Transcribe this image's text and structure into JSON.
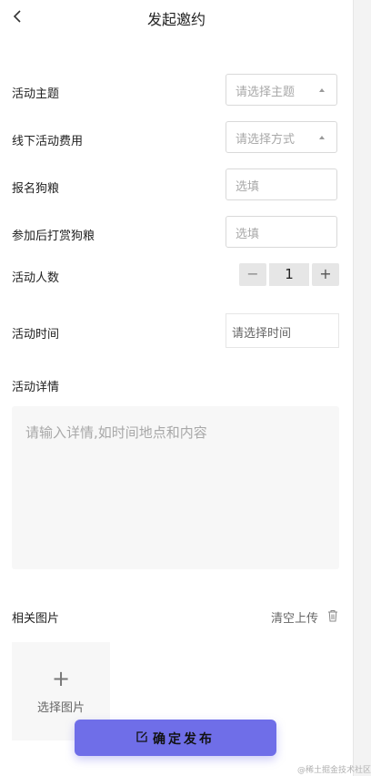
{
  "header": {
    "title": "发起邀约"
  },
  "form": {
    "topic": {
      "label": "活动主题",
      "placeholder": "请选择主题"
    },
    "offline_fee": {
      "label": "线下活动费用",
      "placeholder": "请选择方式"
    },
    "signup_food": {
      "label": "报名狗粮",
      "placeholder": "选填"
    },
    "reward_food": {
      "label": "参加后打赏狗粮",
      "placeholder": "选填"
    },
    "people": {
      "label": "活动人数",
      "value": "1",
      "minus": "−",
      "plus": "+"
    },
    "time": {
      "label": "活动时间",
      "placeholder": "请选择时间"
    },
    "details": {
      "label": "活动详情",
      "placeholder": "请输入详情,如时间地点和内容"
    },
    "images": {
      "label": "相关图片",
      "clear_label": "清空上传",
      "upload_plus": "+",
      "upload_label": "选择图片"
    }
  },
  "actions": {
    "publish_label": "确定发布"
  },
  "watermark": "@稀土掘金技术社区",
  "icons": {
    "back": "chevron-left-icon",
    "caret": "caret-up-icon",
    "trash": "trash-icon",
    "edit": "edit-icon"
  },
  "colors": {
    "accent": "#6f6ee8",
    "placeholder": "#a8a8a8",
    "field_bg": "#f7f7f7"
  }
}
